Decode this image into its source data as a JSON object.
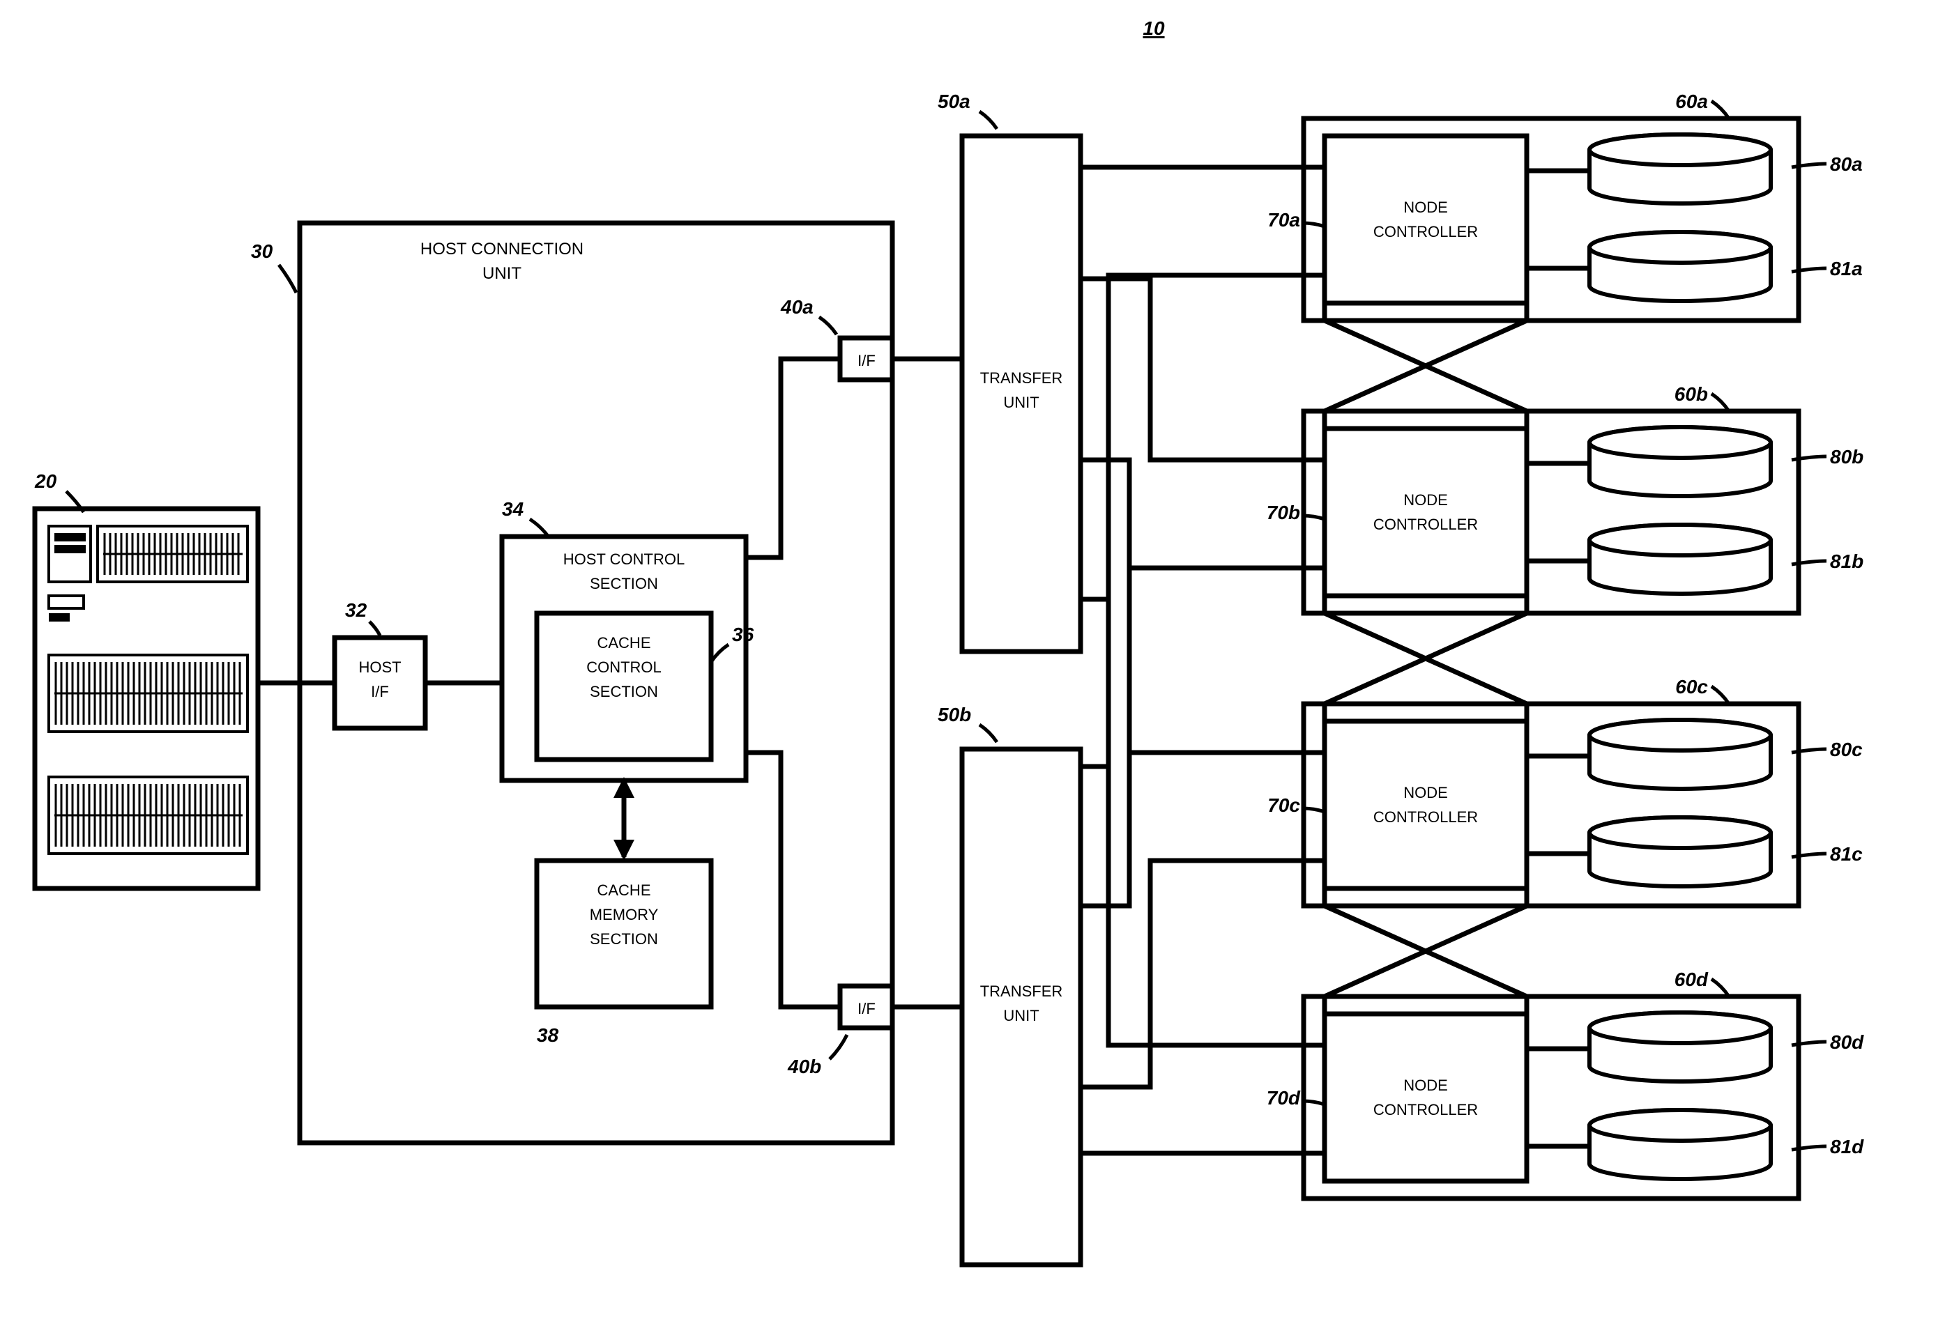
{
  "figure_ref": "10",
  "host_computer": {
    "ref": "20"
  },
  "host_connection_unit": {
    "ref": "30",
    "title_line1": "HOST CONNECTION",
    "title_line2": "UNIT",
    "host_if": {
      "ref": "32",
      "label_line1": "HOST",
      "label_line2": "I/F"
    },
    "host_control": {
      "ref": "34",
      "label_line1": "HOST CONTROL",
      "label_line2": "SECTION"
    },
    "cache_control": {
      "ref": "36",
      "label_line1": "CACHE",
      "label_line2": "CONTROL",
      "label_line3": "SECTION"
    },
    "cache_memory": {
      "ref": "38",
      "label_line1": "CACHE",
      "label_line2": "MEMORY",
      "label_line3": "SECTION"
    },
    "if_a": {
      "ref": "40a",
      "label": "I/F"
    },
    "if_b": {
      "ref": "40b",
      "label": "I/F"
    }
  },
  "transfer_units": {
    "a": {
      "ref": "50a",
      "label_line1": "TRANSFER",
      "label_line2": "UNIT"
    },
    "b": {
      "ref": "50b",
      "label_line1": "TRANSFER",
      "label_line2": "UNIT"
    }
  },
  "nodes": {
    "a": {
      "ref": "60a",
      "ctrl_ref": "70a",
      "ctrl_label_line1": "NODE",
      "ctrl_label_line2": "CONTROLLER",
      "disk0_ref": "80a",
      "disk1_ref": "81a"
    },
    "b": {
      "ref": "60b",
      "ctrl_ref": "70b",
      "ctrl_label_line1": "NODE",
      "ctrl_label_line2": "CONTROLLER",
      "disk0_ref": "80b",
      "disk1_ref": "81b"
    },
    "c": {
      "ref": "60c",
      "ctrl_ref": "70c",
      "ctrl_label_line1": "NODE",
      "ctrl_label_line2": "CONTROLLER",
      "disk0_ref": "80c",
      "disk1_ref": "81c"
    },
    "d": {
      "ref": "60d",
      "ctrl_ref": "70d",
      "ctrl_label_line1": "NODE",
      "ctrl_label_line2": "CONTROLLER",
      "disk0_ref": "80d",
      "disk1_ref": "81d"
    }
  }
}
